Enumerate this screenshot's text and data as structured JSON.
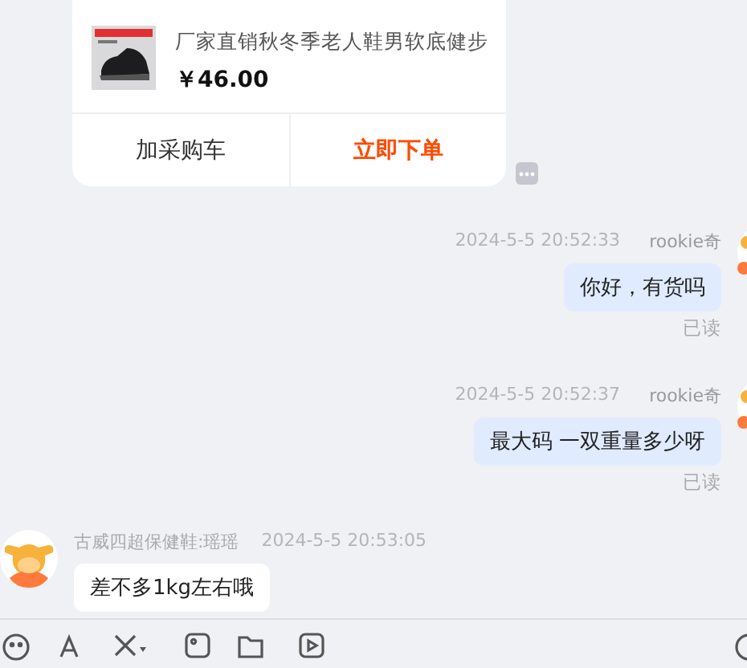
{
  "product_card": {
    "title": "厂家直销秋冬季老人鞋男软底健步",
    "price": "￥46.00",
    "buttons": [
      {
        "label": "加采购车",
        "kind": "secondary"
      },
      {
        "label": "立即下单",
        "kind": "primary"
      }
    ]
  },
  "messages": [
    {
      "kind": "sent",
      "time": "2024-5-5 20:52:33",
      "sender": "rookie奇",
      "text": "你好，有货吗",
      "status": "已读"
    },
    {
      "kind": "sent",
      "time": "2024-5-5 20:52:37",
      "sender": "rookie奇",
      "text": "最大码  一双重量多少呀",
      "status": "已读"
    },
    {
      "kind": "received",
      "time": "2024-5-5 20:53:05",
      "sender": "古威四超保健鞋:瑶瑶",
      "text": "差不多1kg左右哦"
    }
  ]
}
